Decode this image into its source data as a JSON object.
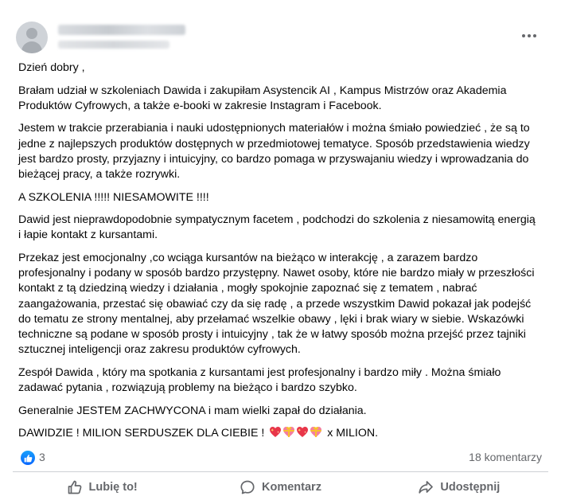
{
  "post": {
    "menu_icon": "more-horizontal-icon",
    "paragraphs": {
      "greeting": "Dzień dobry ,",
      "p1": "Brałam udział w szkoleniach Dawida i zakupiłam Asystencik AI , Kampus Mistrzów oraz Akademia Produktów Cyfrowych, a także e-booki w zakresie Instagram i Facebook.",
      "p2": "Jestem w trakcie przerabiania i nauki udostępnionych materiałów i można śmiało powiedzieć , że są to jedne z najlepszych produktów dostępnych w przedmiotowej tematyce. Sposób przedstawienia wiedzy jest bardzo prosty, przyjazny i intuicyjny, co bardzo pomaga w przyswajaniu wiedzy i wprowadzania do bieżącej pracy, a także rozrywki.",
      "p3": "A SZKOLENIA !!!!! NIESAMOWITE !!!!",
      "p4": "Dawid jest nieprawdopodobnie sympatycznym facetem , podchodzi do szkolenia z niesamowitą energią i łapie kontakt z kursantami.",
      "p5": "Przekaz jest emocjonalny ,co wciąga kursantów na bieżąco w interakcję , a zarazem bardzo profesjonalny i podany w sposób bardzo przystępny. Nawet osoby, które nie bardzo miały w przeszłości kontakt z tą dziedziną wiedzy i działania , mogły spokojnie zapoznać się z tematem , nabrać zaangażowania, przestać się obawiać czy da się radę , a przede wszystkim Dawid pokazał jak podejść do tematu ze strony mentalnej, aby przełamać wszelkie obawy , lęki i brak wiary w siebie. Wskazówki techniczne są podane w sposób prosty i intuicyjny , tak że w łatwy sposób można przejść przez tajniki sztucznej inteligencji oraz zakresu produktów cyfrowych.",
      "p6": "Zespół Dawida , który ma spotkania z kursantami jest profesjonalny i bardzo miły . Można śmiało zadawać pytania , rozwiązują problemy na bieżąco i bardzo szybko.",
      "p7": "Generalnie JESTEM ZACHWYCONA i mam wielki zapał do działania.",
      "p8_before": "DAWIDZIE ! MILION SERDUSZEK DLA CIEBIE !",
      "p8_after": "x MILION."
    },
    "emoji": [
      "sparkling-heart",
      "gift-heart",
      "sparkling-heart",
      "gift-heart"
    ]
  },
  "stats": {
    "reaction_icon": "like-icon",
    "reactions": "3",
    "comments": "18 komentarzy"
  },
  "actions": {
    "like": "Lubię to!",
    "comment": "Komentarz",
    "share": "Udostępnij"
  },
  "colors": {
    "like_blue": "#0866ff",
    "secondary_text": "#65676b",
    "heart_red": "#e8364a",
    "heart_pink": "#f47ea0",
    "ribbon_gold": "#f7c12d"
  }
}
